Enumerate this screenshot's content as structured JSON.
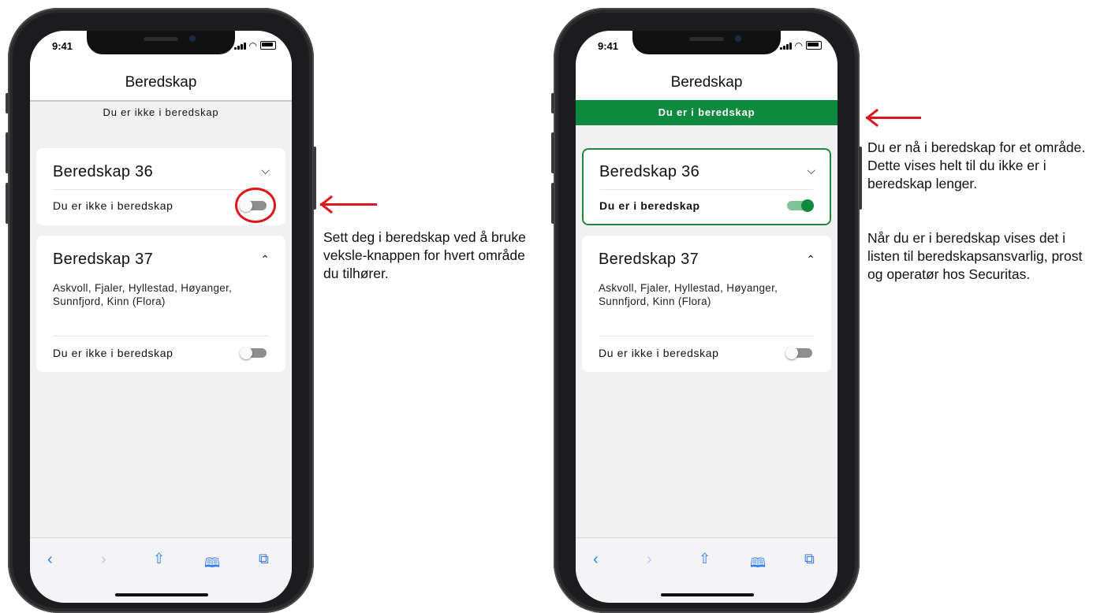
{
  "left_phone": {
    "time": "9:41",
    "nav_title": "Beredskap",
    "status_banner": "Du er ikke i beredskap",
    "cards": [
      {
        "title": "Beredskap 36",
        "chevron": "chevron-down-icon",
        "toggle_label": "Du er ikke i beredskap",
        "toggle_on": false
      },
      {
        "title": "Beredskap 37",
        "chevron": "chevron-up-icon",
        "areas": "Askvoll, Fjaler, Hyllestad, Høyanger, Sunnfjord, Kinn (Flora)",
        "toggle_label": "Du er ikke i beredskap",
        "toggle_on": false
      }
    ]
  },
  "right_phone": {
    "time": "9:41",
    "nav_title": "Beredskap",
    "status_banner": "Du er i beredskap",
    "cards": [
      {
        "title": "Beredskap 36",
        "chevron": "chevron-down-icon",
        "toggle_label": "Du er i beredskap",
        "toggle_on": true
      },
      {
        "title": "Beredskap 37",
        "chevron": "chevron-up-icon",
        "areas": "Askvoll, Fjaler, Hyllestad, Høyanger, Sunnfjord, Kinn (Flora)",
        "toggle_label": "Du er ikke i beredskap",
        "toggle_on": false
      }
    ]
  },
  "toolbar_icons": [
    "back-icon",
    "forward-icon",
    "share-icon",
    "bookmarks-icon",
    "tabs-icon"
  ],
  "annotations": {
    "toggle_hint": "Sett deg i beredskap ved å bruke veksle-knappen for hvert område du tilhører.",
    "banner_hint_1": "Du er nå i beredskap for et område. Dette vises helt til du ikke er i beredskap lenger.",
    "banner_hint_2": "Når du er i beredskap vises det i listen til beredskapsansvarlig, prost og operatør hos Securitas."
  },
  "colors": {
    "active_green": "#0d8a3e",
    "annotation_red": "#e0141b",
    "ios_blue": "#2f7cf6"
  }
}
